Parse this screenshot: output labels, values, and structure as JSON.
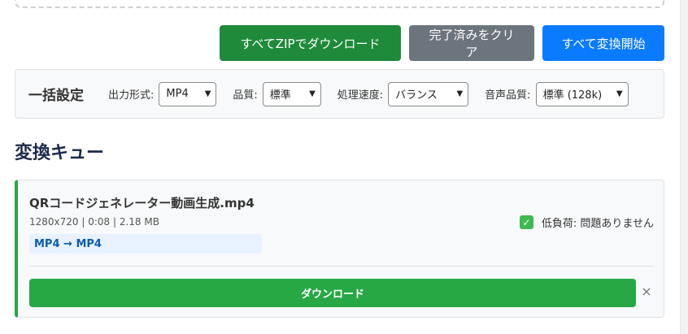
{
  "actions": {
    "zip_label": "すべてZIPでダウンロード",
    "clear_label": "完了済みをクリア",
    "start_label": "すべて変換開始"
  },
  "bulk": {
    "title": "一括設定",
    "format_label": "出力形式:",
    "format_value": "MP4",
    "quality_label": "品質:",
    "quality_value": "標準",
    "speed_label": "処理速度:",
    "speed_value": "バランス",
    "audio_label": "音声品質:",
    "audio_value": "標準 (128k)"
  },
  "queue": {
    "title": "変換キュー",
    "items": [
      {
        "name": "QRコードジェネレーター動画生成.mp4",
        "meta": "1280x720 | 0:08 | 2.18 MB",
        "conversion": "MP4 → MP4",
        "status": "低負荷: 問題ありません",
        "status_icon": "check-icon",
        "download_label": "ダウンロード",
        "remove_symbol": "×"
      }
    ]
  },
  "colors": {
    "zip": "#1f8a3a",
    "clear": "#6c757d",
    "start": "#0a7bff",
    "success": "#28a745"
  }
}
